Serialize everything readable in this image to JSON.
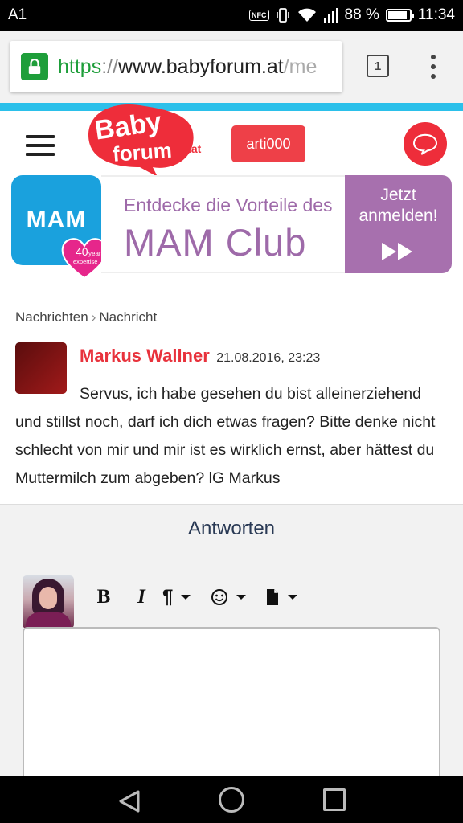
{
  "status_bar": {
    "carrier": "A1",
    "nfc": "NFC",
    "battery_percent": "88 %",
    "battery_level": 0.88,
    "time": "11:34"
  },
  "browser": {
    "url_scheme": "https",
    "url_sep": "://",
    "url_host": "www.babyforum.at",
    "url_path": "/me",
    "tab_count": "1"
  },
  "header": {
    "logo_text": "Baby forum",
    "logo_suffix": ".at",
    "username": "arti000"
  },
  "ad": {
    "brand": "MAM",
    "badge_years": "40",
    "badge_label": "years",
    "badge_sub": "expertise",
    "line1": "Entdecke die Vorteile des",
    "line2": "MAM Club",
    "cta_line1": "Jetzt",
    "cta_line2": "anmelden!"
  },
  "breadcrumb": {
    "items": [
      "Nachrichten",
      "Nachricht"
    ],
    "separator": "›"
  },
  "message": {
    "sender": "Markus Wallner",
    "date": "21.08.2016, 23:23",
    "body": "Servus, ich habe gesehen du bist alleinerziehend und stillst noch, darf ich dich etwas fragen? Bitte denke nicht schlecht von mir und mir ist es wirklich ernst, aber hättest du Muttermilch zum abgeben? lG Markus"
  },
  "reply": {
    "title": "Antworten",
    "toolbar": {
      "bold": "B",
      "italic": "I",
      "paragraph": "¶"
    }
  },
  "colors": {
    "accent_red": "#ee2d3a",
    "stripe": "#2bc0ea",
    "mam_blue": "#1aa1dd",
    "mam_purple": "#a770ae"
  }
}
